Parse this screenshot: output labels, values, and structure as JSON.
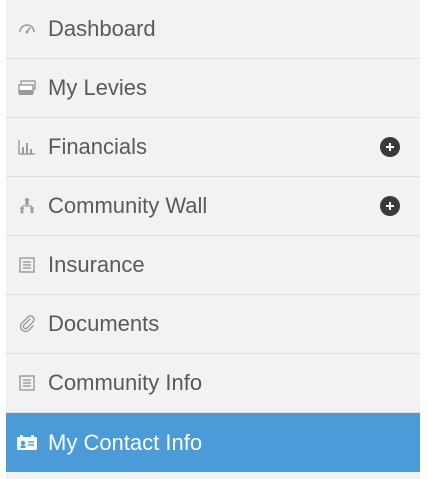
{
  "colors": {
    "sidebar_bg": "#f2f2f2",
    "text": "#5a5a5a",
    "icon": "#9a9a9a",
    "active_bg": "#4a9bd8",
    "active_text": "#ffffff",
    "expand_bg": "#3a3a3a"
  },
  "sidebar": {
    "items": [
      {
        "label": "Dashboard",
        "icon": "dashboard-gauge-icon",
        "expandable": false,
        "active": false
      },
      {
        "label": "My Levies",
        "icon": "stacked-money-icon",
        "expandable": false,
        "active": false
      },
      {
        "label": "Financials",
        "icon": "bar-chart-icon",
        "expandable": true,
        "active": false
      },
      {
        "label": "Community Wall",
        "icon": "people-hierarchy-icon",
        "expandable": true,
        "active": false
      },
      {
        "label": "Insurance",
        "icon": "document-list-icon",
        "expandable": false,
        "active": false
      },
      {
        "label": "Documents",
        "icon": "paperclip-icon",
        "expandable": false,
        "active": false
      },
      {
        "label": "Community Info",
        "icon": "document-list-icon",
        "expandable": false,
        "active": false
      },
      {
        "label": "My Contact Info",
        "icon": "contact-card-icon",
        "expandable": false,
        "active": true
      }
    ]
  }
}
